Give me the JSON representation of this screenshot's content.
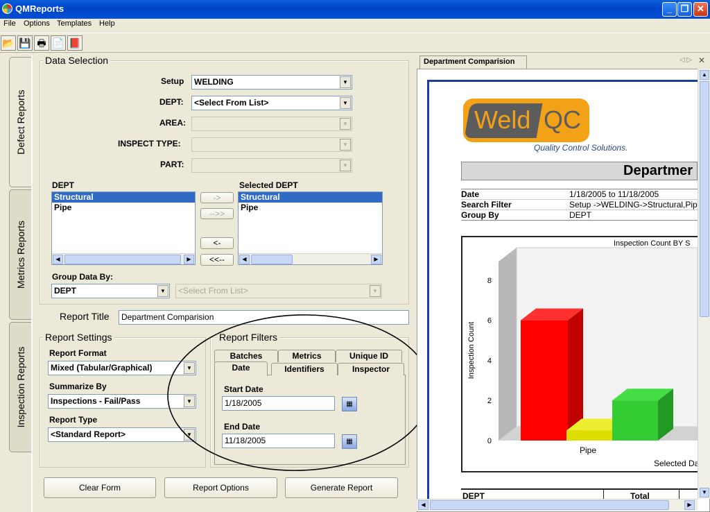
{
  "window": {
    "title": "QMReports"
  },
  "menu": {
    "file": "File",
    "options": "Options",
    "templates": "Templates",
    "help": "Help"
  },
  "toolbar_icons": [
    "open-folder-icon",
    "save-disk-icon",
    "print-icon",
    "report-page-icon",
    "export-icon"
  ],
  "side_tabs": {
    "defect": "Defect Reports",
    "metrics": "Metrics Reports",
    "inspection": "Inspection Reports"
  },
  "data_selection": {
    "title": "Data Selection",
    "setup_label": "Setup",
    "setup_value": "WELDING",
    "dept_label": "DEPT:",
    "dept_value": "<Select From List>",
    "area_label": "AREA:",
    "area_value": "",
    "inspect_type_label": "INSPECT TYPE:",
    "inspect_type_value": "",
    "part_label": "PART:",
    "part_value": "",
    "available_label": "DEPT",
    "available_items": [
      "Structural",
      "Pipe"
    ],
    "selected_label": "Selected DEPT",
    "selected_items": [
      "Structural",
      "Pipe"
    ],
    "move_buttons": {
      "add": "->",
      "add_all": "-->>",
      "remove": "<-",
      "remove_all": "<<--"
    },
    "group_by_label": "Group Data By:",
    "group_by_value": "DEPT",
    "group_by_second": "<Select From List>"
  },
  "report_title": {
    "label": "Report Title",
    "value": "Department Comparision"
  },
  "report_settings": {
    "title": "Report Settings",
    "format_label": "Report Format",
    "format_value": "Mixed (Tabular/Graphical)",
    "summarize_label": "Summarize By",
    "summarize_value": "Inspections - Fail/Pass",
    "type_label": "Report Type",
    "type_value": "<Standard Report>"
  },
  "report_filters": {
    "title": "Report Filters",
    "tabs_back": [
      "Batches",
      "Metrics",
      "Unique ID"
    ],
    "tabs_front": [
      "Date",
      "Identifiers",
      "Inspector"
    ],
    "start_label": "Start Date",
    "start_value": "1/18/2005",
    "end_label": "End Date",
    "end_value": "11/18/2005"
  },
  "buttons": {
    "clear": "Clear Form",
    "options": "Report Options",
    "generate": "Generate Report"
  },
  "preview": {
    "tab": "Department Comparision",
    "logo_a": "Weld",
    "logo_b": "QC",
    "logo_tagline": "Quality Control Solutions.",
    "report_heading": "Departmer",
    "info": [
      {
        "k": "Date",
        "v": "1/18/2005 to 11/18/2005"
      },
      {
        "k": "Search Filter",
        "v": "Setup ->WELDING->Structural,Pip"
      },
      {
        "k": "Group By",
        "v": "DEPT"
      }
    ],
    "table_headers": [
      "DEPT",
      "Total"
    ]
  },
  "chart_data": {
    "type": "bar",
    "title": "Inspection Count BY S",
    "ylabel": "Inspection Count",
    "xlabel": "Selected Da",
    "categories": [
      "Pipe"
    ],
    "yticks": [
      "0",
      "2",
      "4",
      "6",
      "8"
    ],
    "ylim": [
      0,
      9
    ],
    "series_values": [
      6,
      0.5,
      2
    ],
    "colors": [
      "#ff0000",
      "#dddd00",
      "#33cc33"
    ],
    "projection": "3d"
  }
}
